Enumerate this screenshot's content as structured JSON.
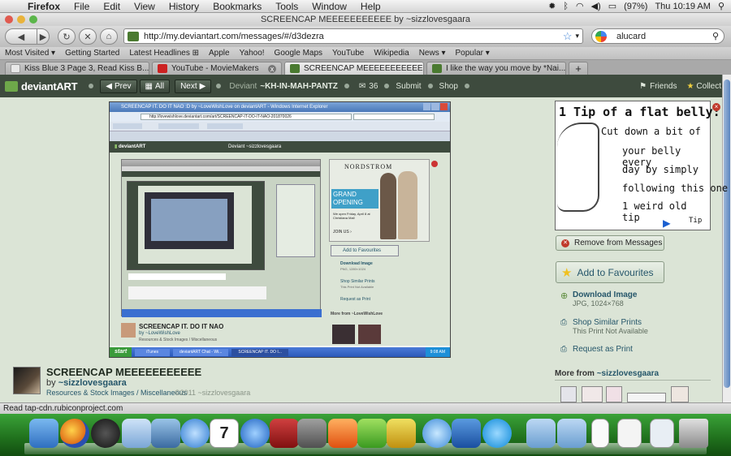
{
  "menubar": {
    "app": "Firefox",
    "items": [
      "File",
      "Edit",
      "View",
      "History",
      "Bookmarks",
      "Tools",
      "Window",
      "Help"
    ],
    "battery": "(97%)",
    "clock": "Thu 10:19 AM"
  },
  "window": {
    "title": "SCREENCAP MEEEEEEEEEEE by ~sizzlovesgaara"
  },
  "nav": {
    "url": "http://my.deviantart.com/messages/#/d3dezra",
    "search_value": "alucard"
  },
  "bookmarks": [
    "Most Visited ▾",
    "Getting Started",
    "Latest Headlines ⊞",
    "Apple",
    "Yahoo!",
    "Google Maps",
    "YouTube",
    "Wikipedia",
    "News ▾",
    "Popular ▾"
  ],
  "tabs": [
    {
      "label": "Kiss Blue 3 Page 3, Read Kiss B...",
      "color": "#e8e8e8"
    },
    {
      "label": "YouTube - MovieMakers",
      "color": "#cc2222"
    },
    {
      "label": "SCREENCAP MEEEEEEEEEEE by ...",
      "color": "#4a7a30"
    },
    {
      "label": "I like the way you move by *Nai...",
      "color": "#4a7a30"
    }
  ],
  "da": {
    "logo": "deviantART",
    "prev": "Prev",
    "all": "All",
    "next": "Next",
    "deviant_prefix": "Deviant",
    "deviant_name": "~KH-IN-MAH-PANTZ",
    "count": "36",
    "submit": "Submit",
    "shop": "Shop",
    "friends": "Friends",
    "collect": "Collect"
  },
  "deviation": {
    "title": "SCREENCAP MEEEEEEEEEEE",
    "by": "by",
    "author": "~sizzlovesgaara",
    "category": "Resources & Stock Images / Miscellaneous",
    "copyright": "©2011 ~sizzlovesgaara"
  },
  "inner": {
    "window_title": "SCREENCAP IT. DO IT NAO :D by ~LoveWishLove on deviantART - Windows Internet Explorer",
    "url": "http://lovewishlove.deviantart.com/art/SCREENCAP-IT-DO-IT-NAO-201870026",
    "deviant": "Deviant ~sizzlovesgaara",
    "ad_brand": "NORDSTROM",
    "ad_grand": "GRAND",
    "ad_opening": "OPENING",
    "ad_text": "We open Friday, April 8 at Christiana Mall",
    "ad_join": "JOIN US ›",
    "add_fav": "Add to Favourites",
    "download": "Download Image",
    "download_sub": "PNG, 1280×1024",
    "similar": "Shop Similar Prints",
    "similar_sub": "This Print Not Available",
    "request": "Request as Print",
    "more_from": "More from ~LoveWishLove",
    "dev_title": "SCREENCAP IT. DO IT NAO",
    "dev_by": "by ~LoveWishLove",
    "dev_cat": "Resources & Stock Images / Miscellaneous",
    "start": "start",
    "task1": "iTunes",
    "task2": "deviantART Chat - Wi...",
    "task3": "SCREENCAP IT. DO I...",
    "clock": "9:08 AM"
  },
  "ad": {
    "line1": "1 Tip of a flat belly:",
    "line2": "Cut down a bit of",
    "line3": "your belly every",
    "line4": "day by simply",
    "line5": "following this one",
    "line6": "1 weird old tip",
    "tip": "Tip"
  },
  "sidebar": {
    "remove": "Remove from Messages",
    "add_fav": "Add to Favourites",
    "download": "Download Image",
    "download_sub": "JPG, 1024×768",
    "similar": "Shop Similar Prints",
    "similar_sub": "This Print Not Available",
    "request": "Request as Print",
    "more_prefix": "More from",
    "more_author": "~sizzlovesgaara"
  },
  "status": "Read tap-cdn.rubiconproject.com",
  "colors": {
    "accent_green": "#3e4b3e",
    "link": "#25566a",
    "page_bg": "#dbe4d6"
  }
}
